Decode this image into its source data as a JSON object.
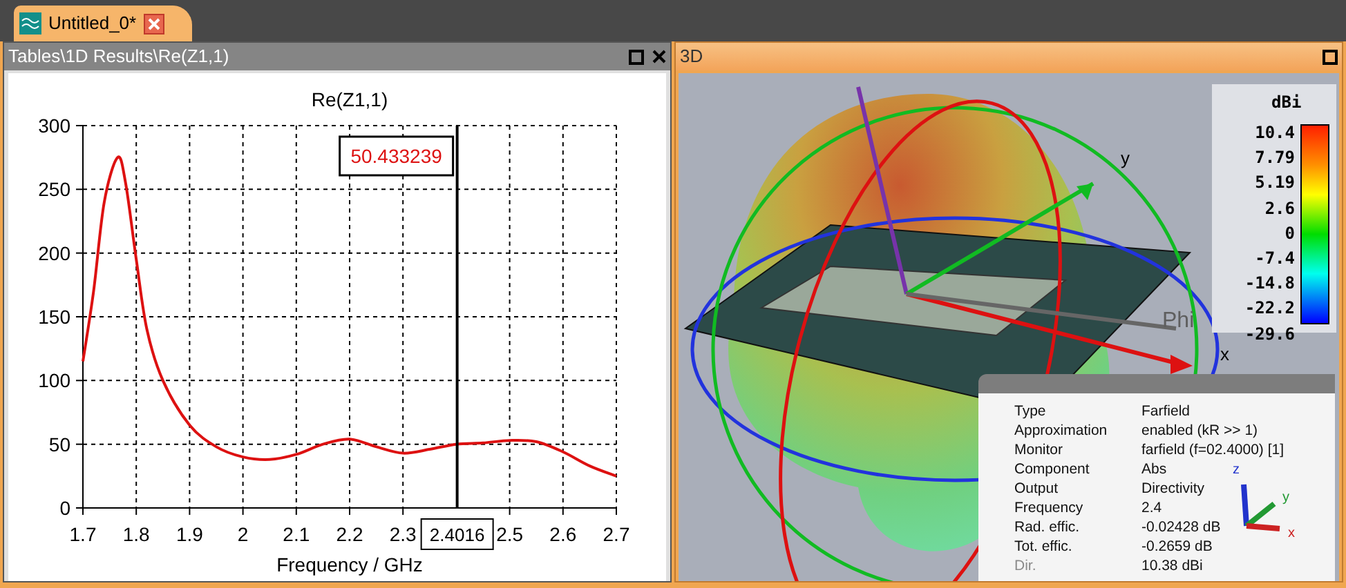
{
  "document_tab": {
    "title": "Untitled_0*",
    "selected": true
  },
  "plot_panel": {
    "title": "Tables\\1D Results\\Re(Z1,1)",
    "chart_data": {
      "type": "line",
      "title": "Re(Z1,1)",
      "xlabel": "Frequency / GHz",
      "xlim": [
        1.7,
        2.7
      ],
      "ylim": [
        0,
        300
      ],
      "grid": true,
      "xticks": [
        1.7,
        1.8,
        1.9,
        2,
        2.1,
        2.2,
        2.3,
        2.5,
        2.6,
        2.7
      ],
      "yticks": [
        0,
        50,
        100,
        150,
        200,
        250,
        300
      ],
      "ref_lines": [
        {
          "axis": "x",
          "value": 2.4016,
          "label": "2.4016",
          "color": "#000000"
        }
      ],
      "annotations": [
        "50.433239"
      ],
      "x": [
        1.7,
        1.72,
        1.74,
        1.765,
        1.78,
        1.8,
        1.82,
        1.85,
        1.9,
        1.95,
        2.0,
        2.05,
        2.1,
        2.15,
        2.2,
        2.25,
        2.3,
        2.35,
        2.4,
        2.45,
        2.5,
        2.55,
        2.6,
        2.65,
        2.7
      ],
      "series": [
        {
          "color": "#dd1111",
          "values": [
            115,
            170,
            240,
            275,
            255,
            195,
            140,
            100,
            65,
            48,
            40,
            38,
            42,
            50,
            54,
            48,
            43,
            46,
            50,
            51,
            53,
            52,
            44,
            33,
            25
          ]
        }
      ]
    }
  },
  "view_panel": {
    "title": "3D",
    "axis_labels": [
      "y",
      "x"
    ],
    "phi_label": "Phi",
    "legend": {
      "unit": "dBi",
      "ticks": [
        "10.4",
        "7.79",
        "5.19",
        "2.6",
        "0",
        "-7.4",
        "-14.8",
        "-22.2",
        "-29.6"
      ]
    },
    "info": {
      "rows": [
        {
          "label": "Type",
          "value": "Farfield"
        },
        {
          "label": "Approximation",
          "value": "enabled (kR >> 1)"
        },
        {
          "label": "Monitor",
          "value": "farfield (f=02.4000) [1]"
        },
        {
          "label": "Component",
          "value": "Abs"
        },
        {
          "label": "Output",
          "value": "Directivity"
        },
        {
          "label": "Frequency",
          "value": "2.4"
        },
        {
          "label": "Rad. effic.",
          "value": "-0.02428 dB"
        },
        {
          "label": "Tot. effic.",
          "value": "-0.2659 dB"
        },
        {
          "label": "Dir.",
          "value": "10.38 dBi"
        }
      ],
      "triad_labels": [
        "z",
        "y",
        "x"
      ]
    }
  }
}
